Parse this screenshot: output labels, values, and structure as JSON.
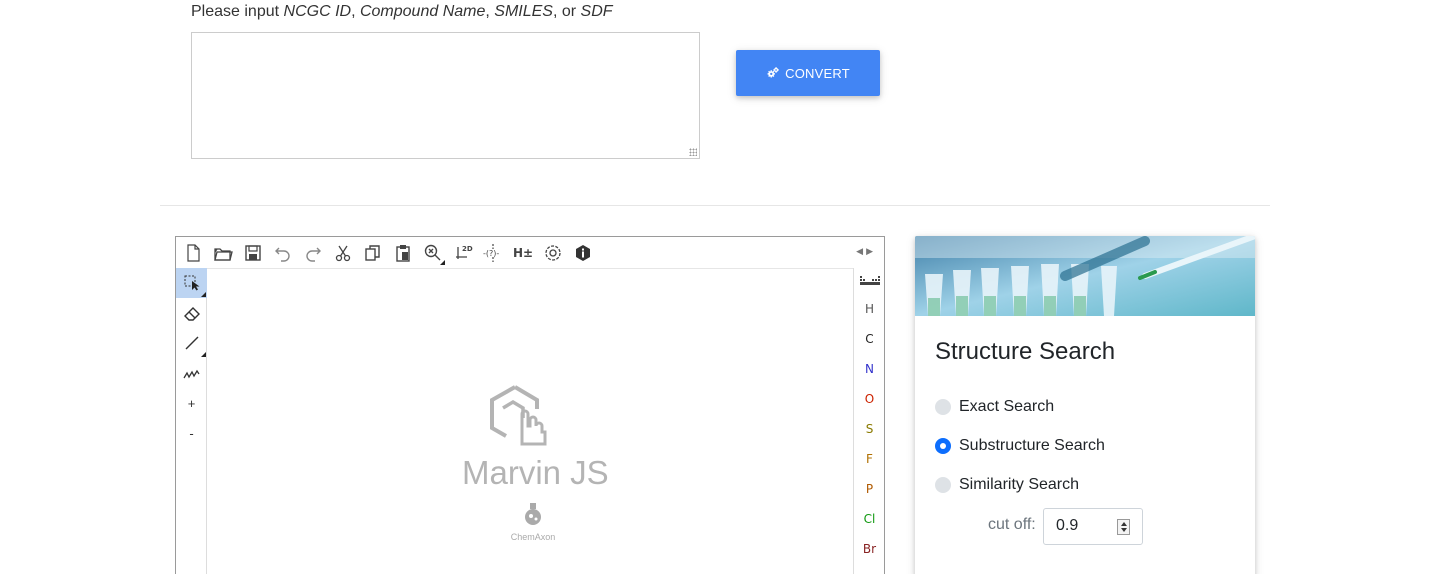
{
  "prompt": {
    "prefix": "Please input ",
    "ncgc": "NCGC ID",
    "sep1": ", ",
    "compound": "Compound Name",
    "sep2": ", ",
    "smiles": "SMILES",
    "sep3": ", or ",
    "sdf": "SDF"
  },
  "input": {
    "value": ""
  },
  "convert": {
    "label": "CONVERT",
    "icon": "gears-icon",
    "color": "#4285f4"
  },
  "marvin": {
    "toolbar": [
      "new-document-icon",
      "open-folder-icon",
      "save-icon",
      "undo-icon",
      "redo-icon",
      "cut-icon",
      "copy-icon",
      "paste-icon",
      "zoom-icon",
      "clean-2d-icon",
      "query-bond-icon",
      "hydrogens-icon",
      "settings-icon",
      "info-icon"
    ],
    "clean_label": "2D",
    "query_label": "-(?)-",
    "hydrogen_label": "H±",
    "left_tools": [
      "selection-icon",
      "eraser-icon",
      "single-bond-icon",
      "chain-icon"
    ],
    "plus": "+",
    "minus": "-",
    "atoms": [
      {
        "symbol": "H",
        "color": "#555555"
      },
      {
        "symbol": "C",
        "color": "#222222"
      },
      {
        "symbol": "N",
        "color": "#3333cc"
      },
      {
        "symbol": "O",
        "color": "#cc2200"
      },
      {
        "symbol": "S",
        "color": "#8a7a00"
      },
      {
        "symbol": "F",
        "color": "#b07000"
      },
      {
        "symbol": "P",
        "color": "#b05a00"
      },
      {
        "symbol": "Cl",
        "color": "#119911"
      },
      {
        "symbol": "Br",
        "color": "#882222"
      }
    ],
    "logo_text": "Marvin JS",
    "brand": "ChemAxon"
  },
  "search": {
    "title": "Structure Search",
    "options": [
      {
        "label": "Exact Search",
        "checked": false
      },
      {
        "label": "Substructure Search",
        "checked": true
      },
      {
        "label": "Similarity Search",
        "checked": false
      }
    ],
    "cutoff_label": "cut off:",
    "cutoff_value": "0.9"
  }
}
